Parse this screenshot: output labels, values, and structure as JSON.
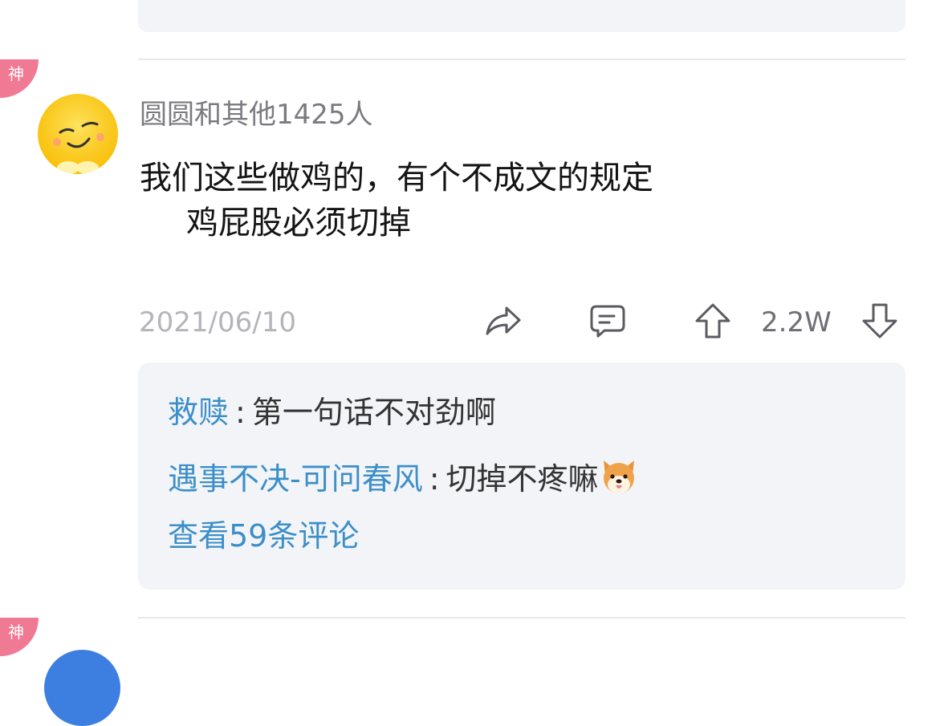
{
  "badge_label": "神",
  "comment": {
    "username": "圆圆和其他1425人",
    "content_line1": "我们这些做鸡的，有个不成文的规定",
    "content_line2": "鸡屁股必须切掉",
    "date": "2021/06/10",
    "vote_count": "2.2W",
    "icons": [
      "share-icon",
      "comment-icon",
      "upvote-icon",
      "downvote-icon"
    ]
  },
  "replies": [
    {
      "author": "救赎",
      "separator": ":",
      "text": "第一句话不对劲啊"
    },
    {
      "author": "遇事不决-可问春风",
      "separator": ":",
      "text": "切掉不疼嘛",
      "emoji": "shiba-dog-emoji"
    }
  ],
  "view_more_label": "查看59条评论",
  "colors": {
    "link_blue": "#3c8fc8",
    "badge_pink": "#f07a94",
    "card_bg": "#f3f4f8",
    "avatar_yellow": "#ffd21f"
  }
}
